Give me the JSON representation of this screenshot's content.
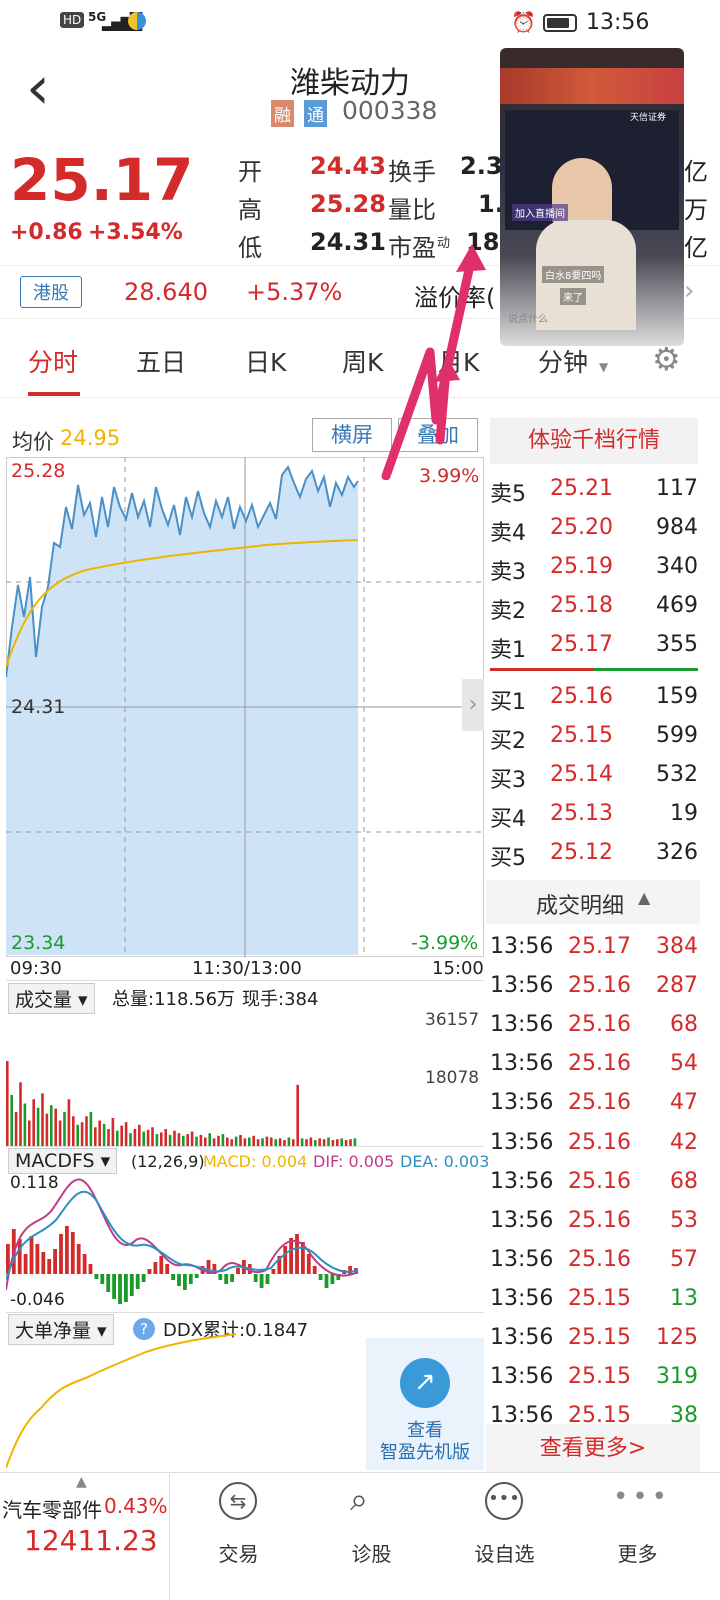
{
  "status_bar": {
    "hd": "HD",
    "net": "5G",
    "time": "13:56"
  },
  "header": {
    "back": "‹",
    "title": "潍柴动力",
    "tag_rong": "融",
    "tag_tong": "通",
    "code": "000338"
  },
  "quote": {
    "price": "25.17",
    "change": "+0.86",
    "change_pct": "+3.54%",
    "open_label": "开",
    "open": "24.43",
    "turnover_label": "换手",
    "turnover": "2.37",
    "high_label": "高",
    "high": "25.28",
    "vol_ratio_label": "量比",
    "vol_ratio": "1.",
    "low_label": "低",
    "low": "24.31",
    "pe_label": "市盈",
    "pe_sup": "动",
    "pe": "18.",
    "r1": "亿",
    "r2": "万",
    "r3": "亿"
  },
  "hk": {
    "badge": "港股",
    "price": "28.640",
    "pct": "+5.37%",
    "premium_label": "溢价率("
  },
  "tabs": [
    "分时",
    "五日",
    "日K",
    "周K",
    "月K",
    "分钟"
  ],
  "chart": {
    "avg_label": "均价",
    "avg_value": "24.95",
    "btn_landscape": "横屏",
    "btn_overlay": "叠加",
    "top_price": "25.28",
    "top_pct": "3.99%",
    "mid_price": "24.31",
    "bot_price": "23.34",
    "bot_pct": "-3.99%",
    "time_start": "09:30",
    "time_mid": "11:30/13:00",
    "time_end": "15:00"
  },
  "volume": {
    "label": "成交量",
    "total": "总量:118.56万",
    "now": "现手:384",
    "max": "36157",
    "half": "18078"
  },
  "macd": {
    "label": "MACDFS",
    "params": "(12,26,9)",
    "macd": "MACD: 0.004",
    "dif": "DIF: 0.005",
    "dea": "DEA: 0.003",
    "top": "0.118",
    "bottom": "-0.046"
  },
  "ddx": {
    "label": "大单净量",
    "value": "DDX累计:0.1847"
  },
  "promo": {
    "line1": "查看",
    "line2": "智盈先机版"
  },
  "orderbook": {
    "title": "体验千档行情",
    "asks": [
      {
        "label": "卖5",
        "price": "25.21",
        "vol": "117"
      },
      {
        "label": "卖4",
        "price": "25.20",
        "vol": "984"
      },
      {
        "label": "卖3",
        "price": "25.19",
        "vol": "340"
      },
      {
        "label": "卖2",
        "price": "25.18",
        "vol": "469"
      },
      {
        "label": "卖1",
        "price": "25.17",
        "vol": "355"
      }
    ],
    "bids": [
      {
        "label": "买1",
        "price": "25.16",
        "vol": "159"
      },
      {
        "label": "买2",
        "price": "25.15",
        "vol": "599"
      },
      {
        "label": "买3",
        "price": "25.14",
        "vol": "532"
      },
      {
        "label": "买4",
        "price": "25.13",
        "vol": "19"
      },
      {
        "label": "买5",
        "price": "25.12",
        "vol": "326"
      }
    ]
  },
  "trades": {
    "title": "成交明细",
    "rows": [
      {
        "time": "13:56",
        "price": "25.17",
        "vol": "384",
        "side": "buy"
      },
      {
        "time": "13:56",
        "price": "25.16",
        "vol": "287",
        "side": "buy"
      },
      {
        "time": "13:56",
        "price": "25.16",
        "vol": "68",
        "side": "buy"
      },
      {
        "time": "13:56",
        "price": "25.16",
        "vol": "54",
        "side": "buy"
      },
      {
        "time": "13:56",
        "price": "25.16",
        "vol": "47",
        "side": "buy"
      },
      {
        "time": "13:56",
        "price": "25.16",
        "vol": "42",
        "side": "buy"
      },
      {
        "time": "13:56",
        "price": "25.16",
        "vol": "68",
        "side": "buy"
      },
      {
        "time": "13:56",
        "price": "25.16",
        "vol": "53",
        "side": "buy"
      },
      {
        "time": "13:56",
        "price": "25.16",
        "vol": "57",
        "side": "buy"
      },
      {
        "time": "13:56",
        "price": "25.15",
        "vol": "13",
        "side": "sell"
      },
      {
        "time": "13:56",
        "price": "25.15",
        "vol": "125",
        "side": "buy"
      },
      {
        "time": "13:56",
        "price": "25.15",
        "vol": "319",
        "side": "sell"
      },
      {
        "time": "13:56",
        "price": "25.15",
        "vol": "38",
        "side": "sell"
      }
    ],
    "more": "查看更多>"
  },
  "bottom": {
    "sector_name": "汽车零部件",
    "sector_pct": "0.43%",
    "sector_index": "12411.23",
    "nav": [
      "交易",
      "诊股",
      "设自选",
      "更多"
    ]
  },
  "pip": {
    "l1": "天信证券",
    "l2": "加入直播间",
    "l3": "白水8要四吗",
    "l4": "来了",
    "l5": "说点什么"
  },
  "colors": {
    "up": "#d32a2a",
    "down": "#1a9a2a",
    "avg": "#f0b400",
    "price_line": "#4a90c8",
    "arrow": "#e0306a"
  }
}
